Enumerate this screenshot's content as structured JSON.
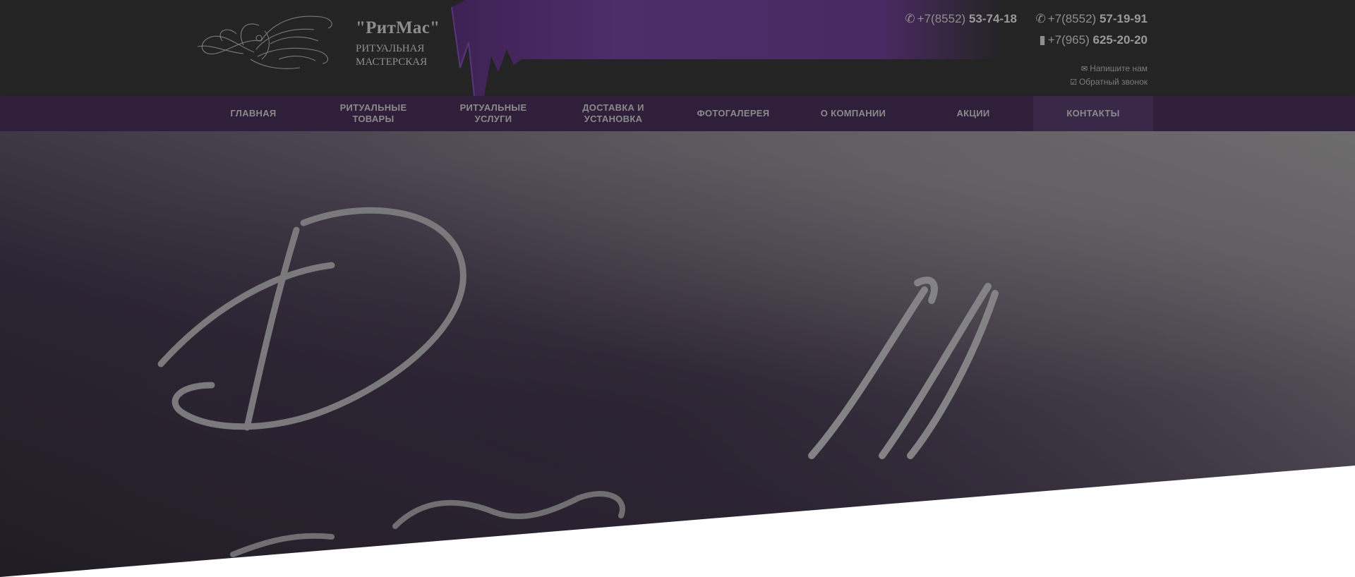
{
  "brand": {
    "name": "\"РитМас\"",
    "subtitle_line1": "РИТУАЛЬНАЯ",
    "subtitle_line2": "МАСТЕРСКАЯ"
  },
  "contacts": {
    "phone1_prefix": "+7(8552) ",
    "phone1_main": "53-74-18",
    "phone2_prefix": "+7(8552) ",
    "phone2_main": "57-19-91",
    "phone3_prefix": "+7(965) ",
    "phone3_main": "625-20-20",
    "write_us": "Напишите нам",
    "callback": "Обратный звонок"
  },
  "icons": {
    "phone1": "phone-icon",
    "phone2": "phone-icon",
    "phone3": "mobile-icon",
    "write_us": "envelope-icon",
    "callback": "checkbox-icon"
  },
  "nav": {
    "items": [
      {
        "label": "ГЛАВНАЯ"
      },
      {
        "label": "РИТУАЛЬНЫЕ ТОВАРЫ"
      },
      {
        "label": "РИТУАЛЬНЫЕ УСЛУГИ"
      },
      {
        "label": "ДОСТАВКА И УСТАНОВКА"
      },
      {
        "label": "ФОТОГАЛЕРЕЯ"
      },
      {
        "label": "О КОМПАНИИ"
      },
      {
        "label": "АКЦИИ"
      },
      {
        "label": "КОНТАКТЫ"
      }
    ],
    "active": "КОНТАКТЫ"
  },
  "colors": {
    "header_bg": "#242424",
    "accent_purple": "#4a2a62",
    "nav_bg": "#2f1f3a",
    "text_gray": "#8e8e8e",
    "hero_dark": "#2b2630",
    "footer_white": "#ffffff"
  }
}
